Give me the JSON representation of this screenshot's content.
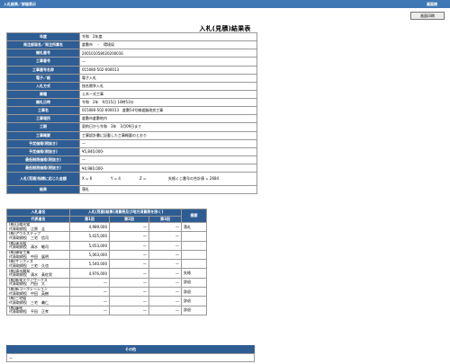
{
  "window": {
    "title": "入札結果／詳細表示",
    "close": "画面閉"
  },
  "toolbar": {
    "print_label": "画面印刷"
  },
  "page_title": "入札(見積)結果表",
  "info": [
    {
      "label": "年度",
      "value": "令和　2年度"
    },
    {
      "label": "発注部局名／発注所属名",
      "value": "倉敷市　・　環境局"
    },
    {
      "label": "開札番号",
      "value": "200101058020200016"
    },
    {
      "label": "工事番号",
      "value": "—"
    },
    {
      "label": "工事番号名称",
      "value": "015080-502-000013"
    },
    {
      "label": "電子／紙",
      "value": "電子入札"
    },
    {
      "label": "入札方式",
      "value": "指名競争入札"
    },
    {
      "label": "業種",
      "value": "土木一式工事"
    },
    {
      "label": "開札日時",
      "value": "令和　2年　9月15日 10時53分"
    },
    {
      "label": "工事名",
      "value": "015080-502-000013　倉敷54号線道路改良工事"
    },
    {
      "label": "工事場所",
      "value": "倉敷市倉敷地内"
    },
    {
      "label": "工期",
      "value": "契約日から令和　3年　3月09日まで"
    },
    {
      "label": "工事概要",
      "value": "工事設計書に記載した工事概要のとおり"
    },
    {
      "label": "予定価格(税抜き)",
      "value": "—"
    },
    {
      "label": "予定価格(税抜き)",
      "value": "¥5,840,000-"
    },
    {
      "label": "最低制限価格(税抜き)",
      "value": "—"
    },
    {
      "label": "最低制限価格(税抜き)",
      "value": "¥4,980,000-"
    }
  ],
  "formula": {
    "label": "入札(見積)指標に応じた金額",
    "x": "X = 6",
    "y": "Y = 4",
    "z": "Z =",
    "note": "失格くじ番号の合計値 = 2684"
  },
  "result": {
    "label": "結果",
    "value": "落札"
  },
  "bids": {
    "headers": {
      "company": "入札者名",
      "rep": "代表者名",
      "group": "入札(見積)結果(消費税及び地方消費税を除く)",
      "r1": "第1回",
      "r2": "第2回",
      "r3": "第3回",
      "remark": "摘要"
    },
    "rows": [
      {
        "company": "(株)山陽光電",
        "rep": "代表取締役　江原　圭",
        "r1": "4,989,000",
        "r2": "—",
        "r3": "—",
        "remark": "落札"
      },
      {
        "company": "(株)アウルステップ",
        "rep": "代表取締役　三宅　信司",
        "r1": "5,025,000",
        "r2": "—",
        "r3": "—",
        "remark": ""
      },
      {
        "company": "(株)清水組",
        "rep": "代表取締役　清水　敏司",
        "r1": "5,053,000",
        "r2": "—",
        "r3": "—",
        "remark": ""
      },
      {
        "company": "(株)横塚工業",
        "rep": "代表取締役　中田　展明",
        "r1": "5,063,000",
        "r2": "—",
        "r3": "—",
        "remark": ""
      },
      {
        "company": "(株)サンフィス",
        "rep": "代表取締役　三宅　久也",
        "r1": "5,540,000",
        "r2": "—",
        "r3": "—",
        "remark": ""
      },
      {
        "company": "(株)清水開発",
        "rep": "代表取締役　清水　真佐男",
        "r1": "4,976,000",
        "r2": "—",
        "r3": "—",
        "remark": "失格"
      },
      {
        "company": "(株)新栄テクノワークス",
        "rep": "代表取締役　門田　大",
        "r1": "—",
        "r2": "—",
        "r3": "—",
        "remark": "辞退"
      },
      {
        "company": "(株)新コーポレーション",
        "rep": "代表取締役　中田　英樹",
        "r1": "—",
        "r2": "—",
        "r3": "—",
        "remark": "辞退"
      },
      {
        "company": "(株)三宅組",
        "rep": "代表取締役　三宅　義仁",
        "r1": "—",
        "r2": "—",
        "r3": "—",
        "remark": "辞退"
      },
      {
        "company": "(株)藤原",
        "rep": "代表取締役　平田　正孝",
        "r1": "—",
        "r2": "—",
        "r3": "—",
        "remark": "辞退"
      }
    ]
  },
  "other": {
    "label": "その他",
    "value": "—"
  }
}
